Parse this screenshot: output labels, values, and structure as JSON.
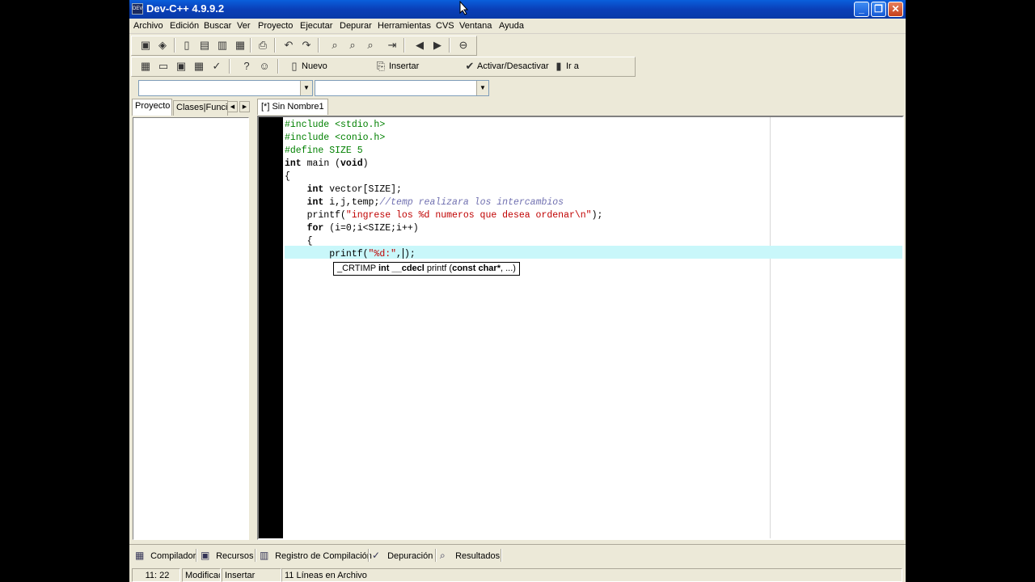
{
  "window": {
    "title": "Dev-C++ 4.9.9.2",
    "minimize": "_",
    "maximize": "❐",
    "close": "✕"
  },
  "menu": [
    "Archivo",
    "Edición",
    "Buscar",
    "Ver",
    "Proyecto",
    "Ejecutar",
    "Depurar",
    "Herramientas",
    "CVS",
    "Ventana",
    "Ayuda"
  ],
  "toolbar2": {
    "new_label": "Nuevo",
    "insert_label": "Insertar",
    "toggle_label": "Activar/Desactivar",
    "goto_label": "Ir a"
  },
  "left_tabs": {
    "project": "Proyecto",
    "classes": "Clases|Funcic"
  },
  "editor": {
    "tab_label": "[*] Sin Nombre1",
    "lines": [
      [
        {
          "t": "#include <stdio.h>",
          "c": "pp"
        }
      ],
      [
        {
          "t": "#include <conio.h>",
          "c": "pp"
        }
      ],
      [
        {
          "t": "#define SIZE 5",
          "c": "pp"
        }
      ],
      [
        {
          "t": "int",
          "c": "kw"
        },
        {
          "t": " main (",
          "c": ""
        },
        {
          "t": "void",
          "c": "kw"
        },
        {
          "t": ")",
          "c": ""
        }
      ],
      [
        {
          "t": "{",
          "c": ""
        }
      ],
      [
        {
          "t": "    ",
          "c": ""
        },
        {
          "t": "int",
          "c": "kw"
        },
        {
          "t": " vector[SIZE];",
          "c": ""
        }
      ],
      [
        {
          "t": "    ",
          "c": ""
        },
        {
          "t": "int",
          "c": "kw"
        },
        {
          "t": " i,j,temp;",
          "c": ""
        },
        {
          "t": "//temp realizara los intercambios",
          "c": "cmt"
        }
      ],
      [
        {
          "t": "    printf(",
          "c": ""
        },
        {
          "t": "\"ingrese los %d numeros que desea ordenar\\n\"",
          "c": "str"
        },
        {
          "t": ");",
          "c": ""
        }
      ],
      [
        {
          "t": "    ",
          "c": ""
        },
        {
          "t": "for",
          "c": "kw"
        },
        {
          "t": " (i=0;i<SIZE;i++)",
          "c": ""
        }
      ],
      [
        {
          "t": "    {",
          "c": ""
        }
      ],
      [
        {
          "t": "        printf(",
          "c": ""
        },
        {
          "t": "\"%d:\"",
          "c": "str"
        },
        {
          "t": ",",
          "c": ""
        },
        {
          "t": "CARET",
          "c": "caret"
        },
        {
          "t": ");",
          "c": ""
        }
      ]
    ],
    "tooltip": [
      {
        "t": "_CRTIMP ",
        "b": false
      },
      {
        "t": "int",
        "b": true
      },
      {
        "t": " ",
        "b": false
      },
      {
        "t": "__cdecl",
        "b": true
      },
      {
        "t": " printf (",
        "b": false
      },
      {
        "t": "const char*",
        "b": true
      },
      {
        "t": ", ...)",
        "b": false
      }
    ]
  },
  "bottom_tabs": [
    "Compilador",
    "Recursos",
    "Registro de Compilación",
    "Depuración",
    "Resultados"
  ],
  "status": {
    "position": "11: 22",
    "modified": "Modificac",
    "mode": "Insertar",
    "lines_info": "11 Líneas en Archivo"
  }
}
